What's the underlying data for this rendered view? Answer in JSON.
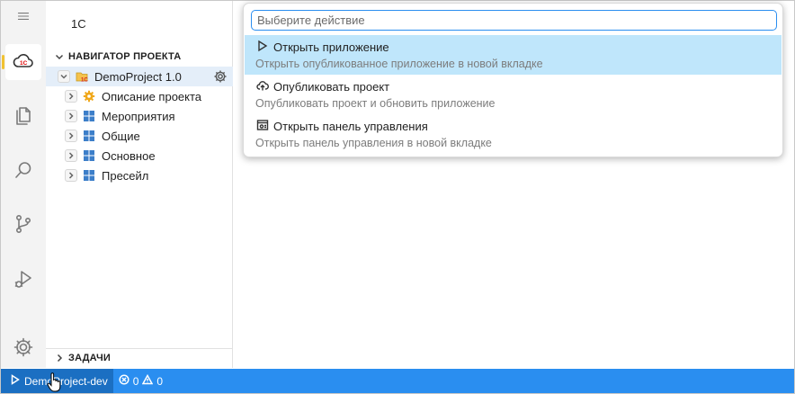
{
  "activity_bar": {
    "items": [
      {
        "icon": "cloud-1c-icon",
        "active": true
      },
      {
        "icon": "files-icon"
      },
      {
        "icon": "search-icon"
      },
      {
        "icon": "source-control-icon"
      },
      {
        "icon": "run-debug-icon"
      },
      {
        "icon": "gear-icon"
      }
    ]
  },
  "sidebar": {
    "title": "1С",
    "navigator_header": "НАВИГАТОР ПРОЕКТА",
    "project": {
      "label": "DemoProject 1.0"
    },
    "children": [
      {
        "label": "Описание проекта",
        "icon": "gear-yellow-icon"
      },
      {
        "label": "Мероприятия",
        "icon": "module-icon"
      },
      {
        "label": "Общие",
        "icon": "module-icon"
      },
      {
        "label": "Основное",
        "icon": "module-icon"
      },
      {
        "label": "Пресейл",
        "icon": "module-icon"
      }
    ],
    "tasks_header": "ЗАДАЧИ"
  },
  "quick_pick": {
    "placeholder": "Выберите действие",
    "items": [
      {
        "label": "Открыть приложение",
        "description": "Открыть опубликованное приложение в новой вкладке",
        "icon": "play-icon",
        "active": true
      },
      {
        "label": "Опубликовать проект",
        "description": "Опубликовать проект и обновить приложение",
        "icon": "cloud-upload-icon"
      },
      {
        "label": "Открыть панель управления",
        "description": "Открыть панель управления в новой вкладке",
        "icon": "dashboard-icon"
      }
    ]
  },
  "statusbar": {
    "run_target": "DemoProject-dev",
    "errors": "0",
    "warnings": "0"
  },
  "colors": {
    "accent": "#2a8ef0",
    "selection": "#bfe6fb",
    "tree_selection": "#e4eef9",
    "active_marker": "#f1c232"
  }
}
